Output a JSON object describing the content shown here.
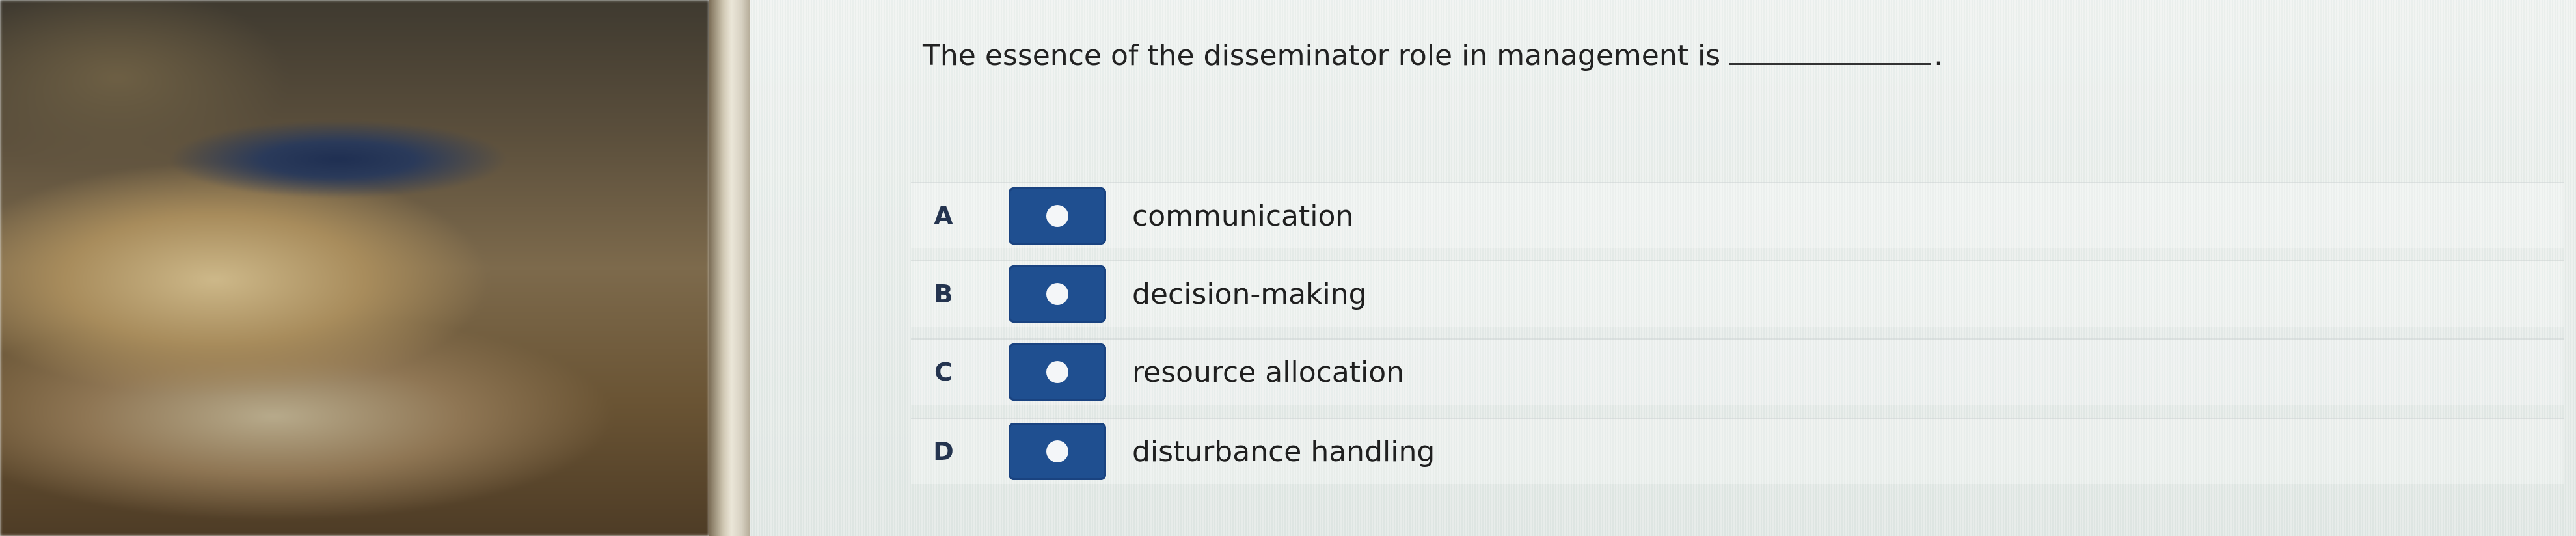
{
  "question": {
    "text": "The essence of the disseminator role in management is",
    "period": "."
  },
  "options": [
    {
      "letter": "A",
      "label": "communication"
    },
    {
      "letter": "B",
      "label": "decision-making"
    },
    {
      "letter": "C",
      "label": "resource allocation"
    },
    {
      "letter": "D",
      "label": "disturbance handling"
    }
  ],
  "colors": {
    "radio_fill": "#1f4f90",
    "letter": "#24344f",
    "text": "#1f1f1f"
  }
}
